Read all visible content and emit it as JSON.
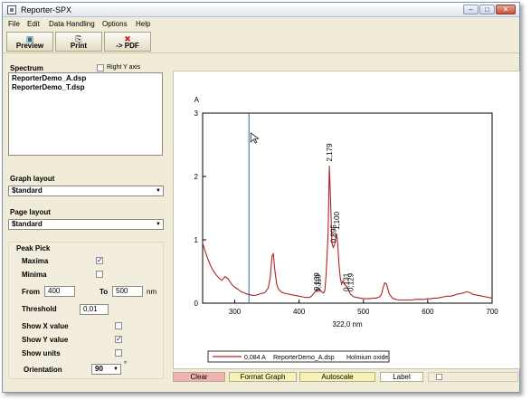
{
  "window": {
    "title": "Reporter-SPX"
  },
  "menu": [
    "File",
    "Edit",
    "Data Handling",
    "Options",
    "Help"
  ],
  "toolbar": {
    "preview": "Preview",
    "print": "Print",
    "pdf": "-> PDF"
  },
  "left": {
    "spectrum_label": "Spectrum",
    "right_y_axis": "Right Y axis",
    "files": [
      "ReporterDemo_A.dsp",
      "ReporterDemo_T.dsp"
    ],
    "graph_layout_label": "Graph layout",
    "graph_layout_value": "$tandard",
    "page_layout_label": "Page layout",
    "page_layout_value": "$tandard"
  },
  "peak": {
    "title": "Peak Pick",
    "maxima": "Maxima",
    "maxima_checked": true,
    "minima": "Minima",
    "minima_checked": false,
    "from_label": "From",
    "from_value": "400",
    "to_label": "To",
    "to_value": "500",
    "unit": "nm",
    "threshold_label": "Threshold",
    "threshold_value": "0,01",
    "show_x": "Show X value",
    "show_x_checked": false,
    "show_y": "Show Y value",
    "show_y_checked": true,
    "show_units": "Show units",
    "show_units_checked": false,
    "orientation_label": "Orientation",
    "orientation_value": "90",
    "degree": "°"
  },
  "status": {
    "clear": "Clear",
    "format_graph": "Format Graph",
    "autoscale": "Autoscale",
    "label": "Label"
  },
  "chart_data": {
    "type": "line",
    "y_unit_label": "A",
    "xlabel": "322,0 nm",
    "xlim": [
      250,
      700
    ],
    "ylim": [
      0,
      3
    ],
    "x_ticks": [
      "300",
      "400",
      "500",
      "600",
      "700"
    ],
    "y_ticks": [
      "0",
      "1",
      "2",
      "3"
    ],
    "cursor_x": 322,
    "series": [
      {
        "name": "ReporterDemo_A.dsp",
        "color": "#b22222",
        "x": [
          250,
          254,
          258,
          262,
          266,
          270,
          275,
          280,
          285,
          290,
          295,
          300,
          305,
          310,
          315,
          320,
          325,
          330,
          335,
          340,
          345,
          348,
          352,
          355,
          358,
          360,
          362,
          365,
          368,
          372,
          376,
          380,
          385,
          390,
          395,
          400,
          405,
          410,
          415,
          418,
          420,
          425,
          430,
          432,
          435,
          438,
          440,
          442,
          445,
          447,
          449,
          451,
          453,
          455,
          458,
          460,
          462,
          464,
          466,
          468,
          470,
          472,
          475,
          478,
          480,
          485,
          490,
          495,
          500,
          505,
          510,
          515,
          520,
          525,
          528,
          530,
          533,
          536,
          538,
          540,
          545,
          550,
          555,
          560,
          565,
          570,
          575,
          580,
          585,
          590,
          595,
          600,
          605,
          610,
          615,
          620,
          625,
          630,
          635,
          640,
          645,
          650,
          655,
          660,
          665,
          670,
          675,
          680,
          685,
          690,
          695,
          700
        ],
        "y": [
          0.95,
          0.82,
          0.7,
          0.6,
          0.52,
          0.46,
          0.4,
          0.36,
          0.42,
          0.38,
          0.3,
          0.25,
          0.22,
          0.18,
          0.16,
          0.14,
          0.13,
          0.12,
          0.13,
          0.15,
          0.16,
          0.18,
          0.24,
          0.4,
          0.75,
          0.78,
          0.55,
          0.3,
          0.22,
          0.18,
          0.16,
          0.15,
          0.14,
          0.13,
          0.12,
          0.11,
          0.1,
          0.09,
          0.09,
          0.1,
          0.12,
          0.18,
          0.22,
          0.21,
          0.18,
          0.16,
          0.2,
          0.45,
          1.1,
          2.17,
          1.6,
          0.95,
          0.88,
          0.92,
          1.1,
          0.95,
          0.6,
          0.4,
          0.3,
          0.35,
          0.32,
          0.28,
          0.25,
          0.18,
          0.14,
          0.1,
          0.09,
          0.08,
          0.07,
          0.07,
          0.07,
          0.08,
          0.08,
          0.1,
          0.14,
          0.22,
          0.32,
          0.3,
          0.22,
          0.15,
          0.08,
          0.06,
          0.05,
          0.05,
          0.05,
          0.05,
          0.05,
          0.06,
          0.06,
          0.06,
          0.06,
          0.07,
          0.07,
          0.08,
          0.08,
          0.09,
          0.1,
          0.11,
          0.11,
          0.12,
          0.14,
          0.15,
          0.16,
          0.18,
          0.17,
          0.14,
          0.13,
          0.12,
          0.11,
          0.1,
          0.09,
          0.08
        ]
      }
    ],
    "peaks": [
      {
        "x": 427,
        "y": 0.139,
        "label": "0,139"
      },
      {
        "x": 429,
        "y": 0.119,
        "label": "0,119"
      },
      {
        "x": 447,
        "y": 2.179,
        "label": "2,179"
      },
      {
        "x": 453,
        "y": 0.895,
        "label": "0,895"
      },
      {
        "x": 458,
        "y": 1.1,
        "label": "1,100"
      },
      {
        "x": 473,
        "y": 0.131,
        "label": "0,131"
      },
      {
        "x": 480,
        "y": 0.129,
        "label": "0,129"
      }
    ],
    "legend": {
      "value": "0,084 A",
      "file": "ReporterDemo_A.dsp",
      "name": "Holmium oxide"
    }
  }
}
